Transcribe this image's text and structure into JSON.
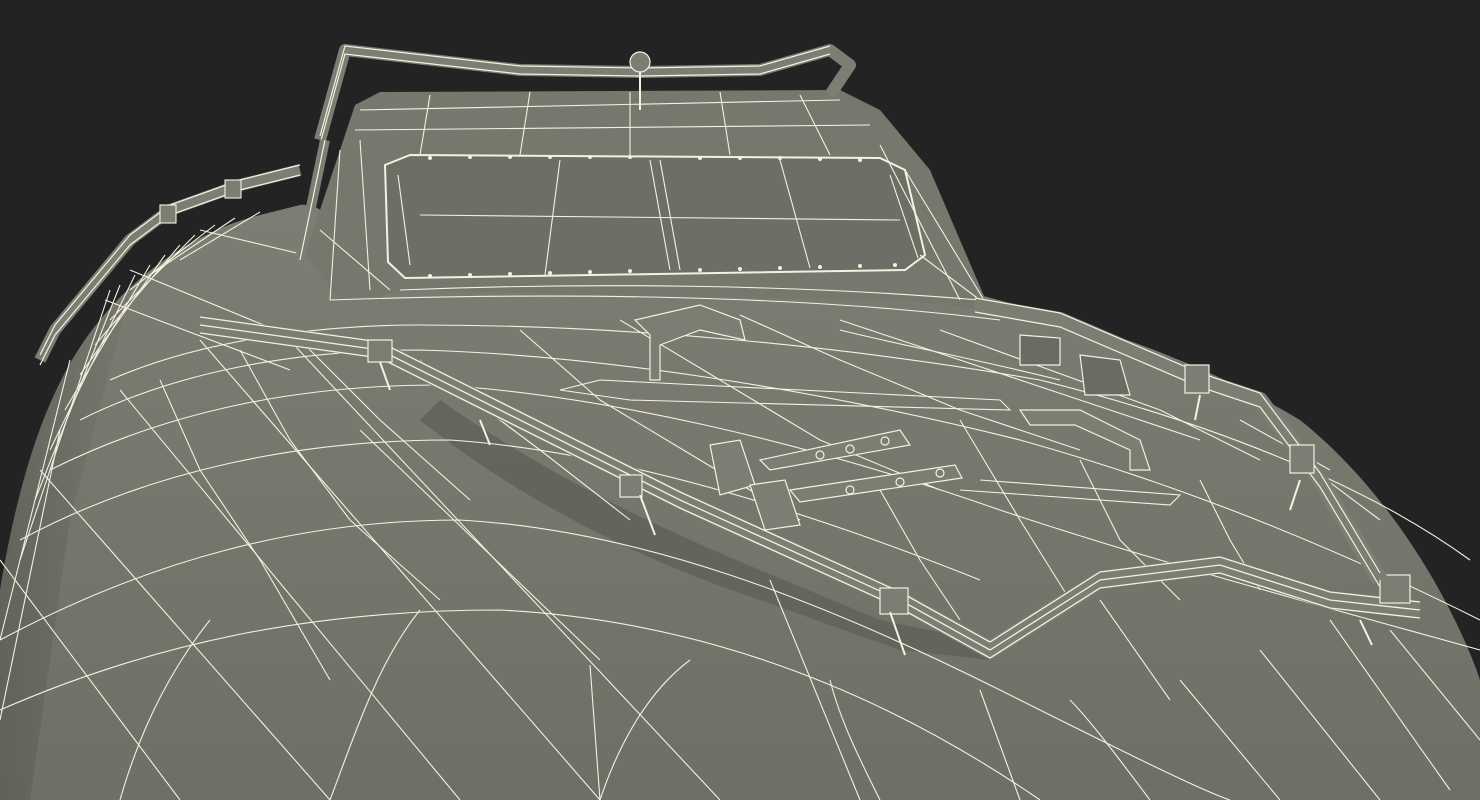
{
  "viewport": {
    "render_style": "wireframe-on-shaded",
    "background_color": "#232323",
    "surface_color": "#74756b",
    "surface_shadow_color": "#5c5d55",
    "wire_color": "#f4f1df"
  },
  "model": {
    "subject": "vehicle-hull-top",
    "parts": [
      "hull-surface",
      "cabin",
      "windshield",
      "front-guard-rail",
      "side-rail",
      "roof-rail",
      "hatch-handles",
      "hinge-plates"
    ]
  }
}
